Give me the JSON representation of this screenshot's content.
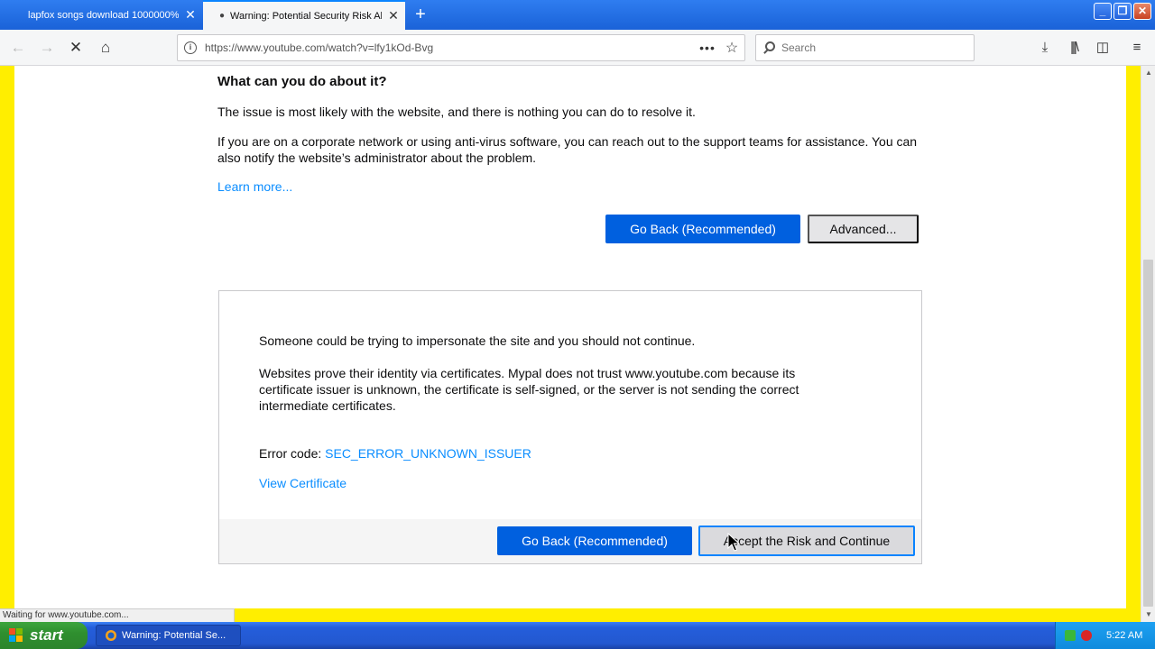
{
  "browser": {
    "tabs": [
      {
        "title": "lapfox songs download 1000000%",
        "active": false
      },
      {
        "title": "Warning: Potential Security Risk Ah",
        "active": true
      }
    ],
    "url": "https://www.youtube.com/watch?v=lfy1kOd-Bvg",
    "search_placeholder": "Search",
    "status": "Waiting for www.youtube.com..."
  },
  "page": {
    "heading": "What can you do about it?",
    "para1": "The issue is most likely with the website, and there is nothing you can do to resolve it.",
    "para2": "If you are on a corporate network or using anti-virus software, you can reach out to the support teams for assistance. You can also notify the website’s administrator about the problem.",
    "learn_more": "Learn more...",
    "go_back": "Go Back (Recommended)",
    "advanced": "Advanced...",
    "panel": {
      "text1": "Someone could be trying to impersonate the site and you should not continue.",
      "text2": "Websites prove their identity via certificates. Mypal does not trust www.youtube.com because its certificate issuer is unknown, the certificate is self-signed, or the server is not sending the correct intermediate certificates.",
      "error_label": "Error code:",
      "error_code": "SEC_ERROR_UNKNOWN_ISSUER",
      "view_certificate": "View Certificate",
      "go_back": "Go Back (Recommended)",
      "accept": "Accept the Risk and Continue"
    }
  },
  "taskbar": {
    "start": "start",
    "task_title": "Warning: Potential Se...",
    "clock": "5:22 AM"
  },
  "colors": {
    "primary_button": "#0060df",
    "link": "#0a8dff",
    "page_border": "#ffee00"
  }
}
